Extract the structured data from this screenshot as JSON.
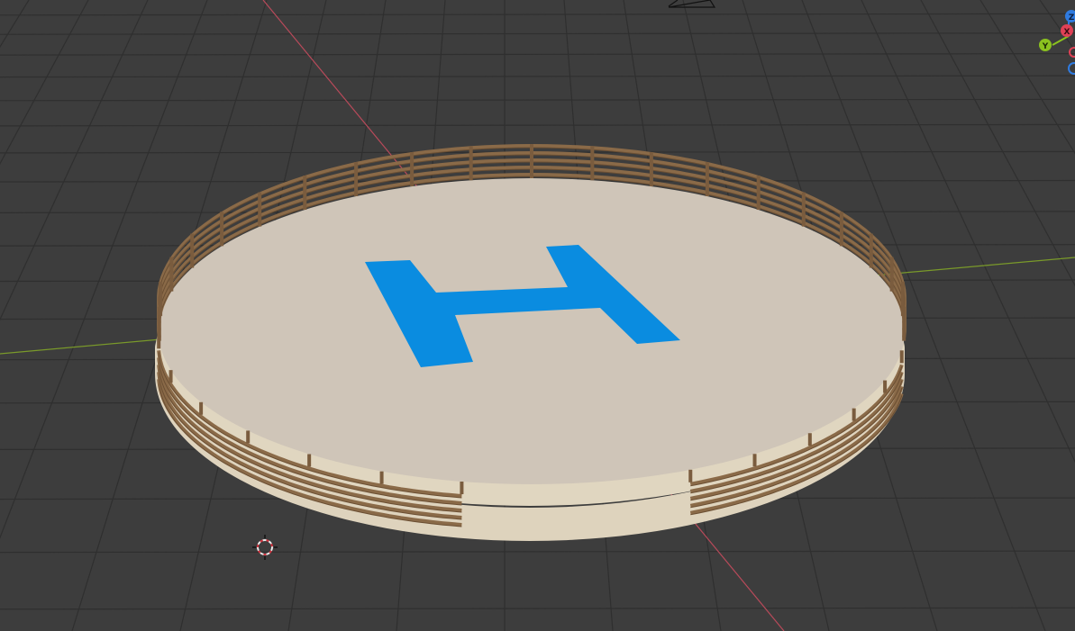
{
  "viewport": {
    "background": "#3d3d3d",
    "grid_color": "#303030",
    "axis_x_color": "#b84a5a",
    "axis_y_color": "#7a9a2a"
  },
  "navigation_gizmo": {
    "axes": [
      {
        "label": "Z",
        "color": "#2f7be0"
      },
      {
        "label": "X",
        "color": "#e04156"
      },
      {
        "label": "Y",
        "color": "#8bc21f"
      }
    ]
  },
  "scene_objects": {
    "helipad": {
      "pad_top_color": "#cfc5b8",
      "pad_side_color": "#ded3bd",
      "marking_text": "H",
      "marking_color": "#0a8ce0",
      "railing_color": "#8a6a48"
    },
    "cursor_3d": {
      "icon": "3d-cursor-icon"
    }
  }
}
